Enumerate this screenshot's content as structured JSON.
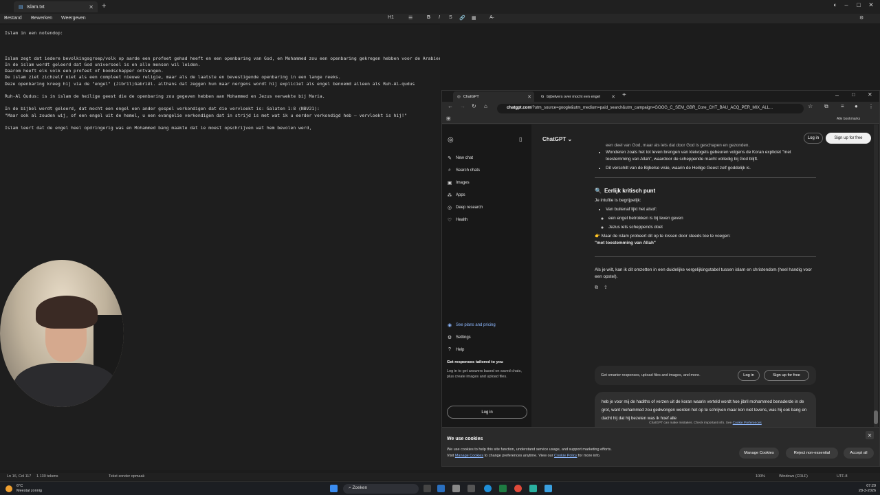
{
  "notepad": {
    "tab_title": "Islam.txt",
    "new_tab": "+",
    "menu": [
      "Bestand",
      "Bewerken",
      "Weergeven"
    ],
    "format_tools": [
      "H1",
      "☰",
      "B",
      "I",
      "S",
      "🔗",
      "▦",
      "A̶"
    ],
    "lines": [
      "Islam in een notendop:",
      "",
      "",
      "",
      "Islam zegt dat iedere bevolkingsgroep/volk op aarde een profeet gehad heeft en een openbaring van God, en Mohammed zou een openbaring gekregen hebben voor de Arabieren.",
      "In de islam wordt geleerd dat God universeel is en alle mensen wil leiden.",
      "Daarom heeft elk volk een profeet of boodschapper ontvangen.",
      "De islam ziet zichzelf niet als een compleet nieuwe religie, maar als de laatste en bevestigende openbaring in een lange reeks.",
      "Deze openbaring kreeg hij via de \"engel\" (Jibril)Gabriël. althans dat zeggen hun maar nergens wordt hij expliciet als engel benoemd alleen als Ruh-Al-qudus",
      "",
      "Ruh-Al Qudus: is in islam de heilige geest die de openbaring zou gegeven hebben aan Mohammed en Jezus verwekte bij Maria.",
      "",
      "In de bijbel wordt geleerd, dat mocht een engel een ander gospel verkondigen dat die vervloekt is: Galaten 1:8 (NBV21):",
      "\"Maar ook al zouden wij, of een engel uit de hemel, u een evangelie verkondigen dat in strijd is met wat ik u eerder verkondigd heb – vervloekt is hij!\"",
      "",
      "Islam leert dat de engel heel opdringerig was en Mohammed bang maakte dat ie moest opschrijven wat hem bevolen werd,"
    ],
    "status": {
      "position": "Ln 16, Col 117",
      "tokens": "1.130 tekens",
      "format": "Tekst zonder opmaak",
      "zoom": "100%",
      "line_ending": "Windows (CRLF)",
      "encoding": "UTF-8"
    }
  },
  "browser": {
    "tabs": [
      {
        "title": "ChatGPT",
        "active": true
      },
      {
        "title": "bijbelvers over mocht een engel",
        "active": false
      }
    ],
    "url_host": "chatgpt.com",
    "url_rest": "/?utm_source=google&utm_medium=paid_search&utm_campaign=GOOG_C_SEM_GBR_Core_CHT_BAU_ACQ_PER_MIX_ALL...",
    "bookmarks_label": "Alle bookmarks"
  },
  "chatgpt": {
    "brand": "ChatGPT",
    "sidebar": {
      "items": [
        {
          "icon": "✎",
          "label": "New chat"
        },
        {
          "icon": "⌕",
          "label": "Search chats"
        },
        {
          "icon": "▣",
          "label": "Images"
        },
        {
          "icon": "⁂",
          "label": "Apps"
        },
        {
          "icon": "◎",
          "label": "Deep research"
        },
        {
          "icon": "♡",
          "label": "Health"
        }
      ],
      "bottom": [
        {
          "icon": "◉",
          "label": "See plans and pricing"
        },
        {
          "icon": "⚙",
          "label": "Settings"
        },
        {
          "icon": "?",
          "label": "Help"
        }
      ],
      "promo_title": "Get responses tailored to you",
      "promo_text": "Log in to get answers based on saved chats, plus create images and upload files.",
      "login": "Log in"
    },
    "header": {
      "login": "Log in",
      "signup": "Sign up for free"
    },
    "chat": {
      "top_fragment": "een deel van God, maar als iets dat door God is geschapen en gezonden.",
      "bullets_top": [
        "Wonderen zoals het tot leven brengen van kleivogels gebeuren volgens de Koran expliciet \"met toestemming van Allah\", waardoor de scheppende macht volledig bij God blijft.",
        "Dit verschilt van de Bijbelse visie, waarin de Heilige Geest zelf goddelijk is."
      ],
      "heading": "Eerlijk kritisch punt",
      "intro": "Je intuïtie is begrijpelijk:",
      "bullet_main": "Van buitenaf lijkt het alsof:",
      "sub_bullets": [
        "een engel betrokken is bij leven geven",
        "Jezus iets scheppends doet"
      ],
      "point_text": "Maar de islam probeert dit op te lossen door steeds toe te voegen:",
      "point_bold": "\"met toestemming van Allah\"",
      "closing": "Als je wilt, kan ik dit omzetten in een duidelijke vergelijkingstabel tussen islam en christendom (heel handig voor een opstel)."
    },
    "promo_bar": {
      "text": "Get smarter responses, upload files and images, and more.",
      "login": "Log in",
      "signup": "Sign up for free"
    },
    "composer_text": "heb je voor mij de hadiths of verzen uit de koran waarin verteld wordt hoe jibril mohammed benaderde in de grot, want mohammed zou gedwongen werden het op te schrijven maar kon niet tevens, was hij ook bang en dacht hij dat hij bezeten was ik hoef alle",
    "disclaimer": "ChatGPT can make mistakes. Check important info. See",
    "disclaimer_link": "Cookie Preferences"
  },
  "cookie": {
    "title": "We use cookies",
    "text1": "We use cookies to help this site function, understand service usage, and support marketing efforts.",
    "visit": "Visit",
    "link1": "Manage Cookies",
    "text2": "to change preferences anytime. View our",
    "link2": "Cookie Policy",
    "text3": "for more info.",
    "manage": "Manage Cookies",
    "reject": "Reject non-essential",
    "accept": "Accept all"
  },
  "taskbar": {
    "temp": "6°C",
    "weather": "Meestal zonnig",
    "search": "Zoeken",
    "time": "07:29",
    "date": "28-3-2026"
  }
}
